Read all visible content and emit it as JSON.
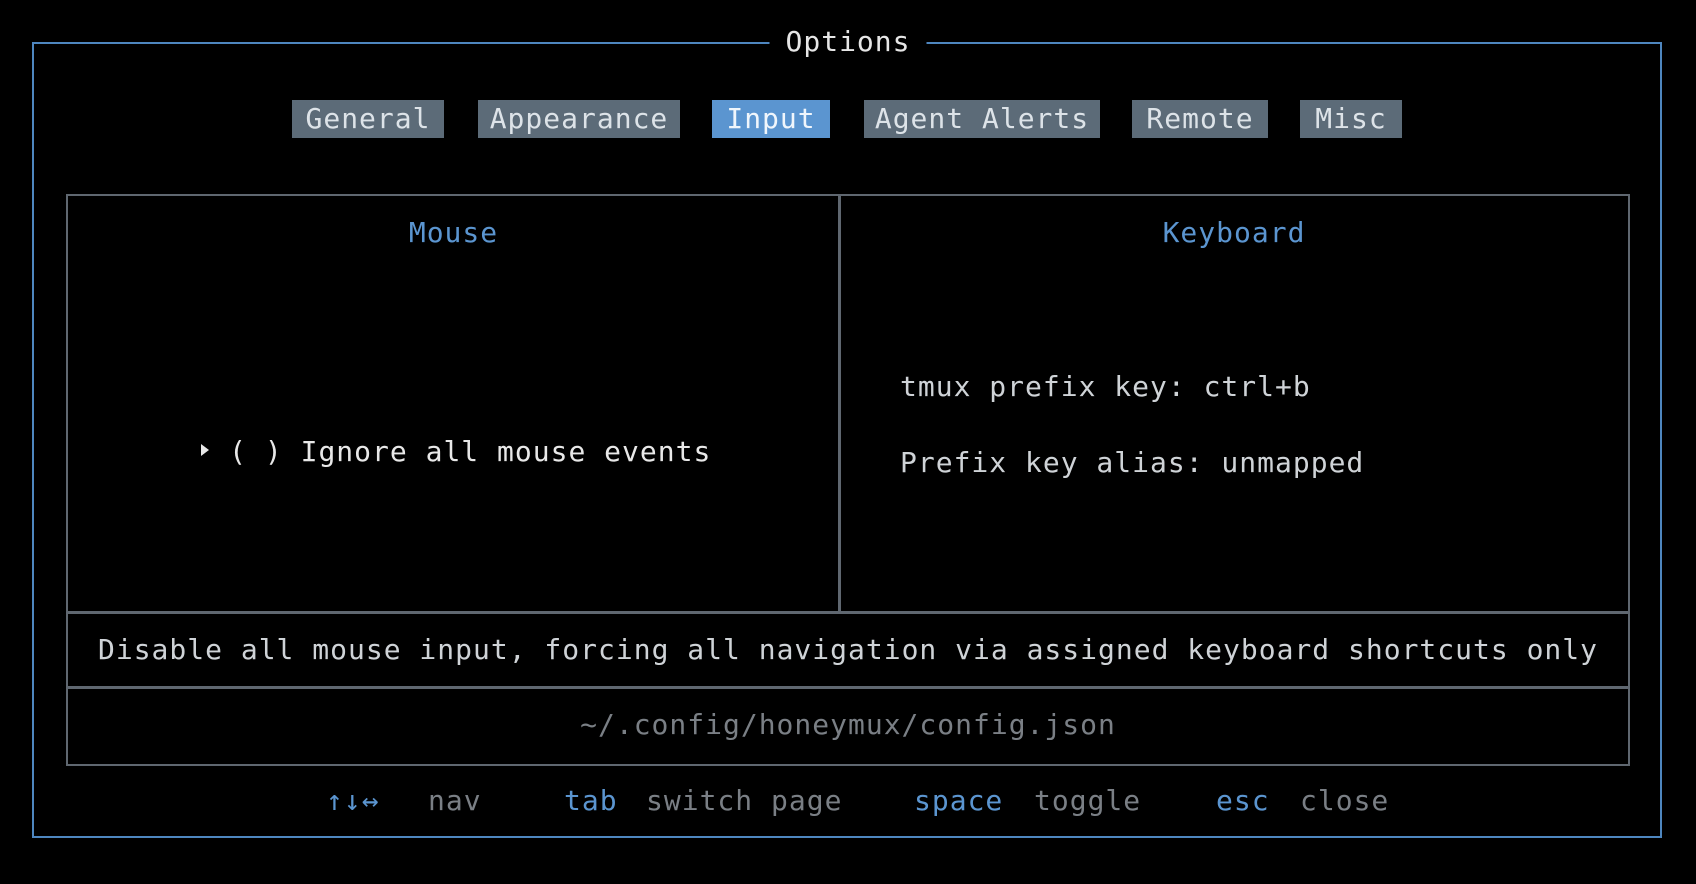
{
  "window": {
    "title": "Options"
  },
  "tabs": [
    {
      "label": "General",
      "active": false
    },
    {
      "label": "Appearance",
      "active": false
    },
    {
      "label": "Input",
      "active": true
    },
    {
      "label": "Agent Alerts",
      "active": false
    },
    {
      "label": "Remote",
      "active": false
    },
    {
      "label": "Misc",
      "active": false
    }
  ],
  "mouse": {
    "heading": "Mouse",
    "options": [
      {
        "checkbox": "( )",
        "label": "Ignore all mouse events",
        "checked": false,
        "selected": true
      }
    ]
  },
  "keyboard": {
    "heading": "Keyboard",
    "lines": [
      "tmux prefix key: ctrl+b",
      "Prefix key alias: unmapped"
    ]
  },
  "description": "Disable all mouse input, forcing all navigation via assigned keyboard shortcuts only",
  "config_path": "~/.config/honeymux/config.json",
  "footer": {
    "hints": [
      {
        "key": "↑↓↔",
        "action": "nav"
      },
      {
        "key": "tab",
        "action": "switch page"
      },
      {
        "key": "space",
        "action": "toggle"
      },
      {
        "key": "esc",
        "action": "close"
      }
    ]
  },
  "colors": {
    "accent": "#5b95d0",
    "frame": "#4e86bf",
    "tab_inactive": "#5c6b78",
    "background": "#000000"
  }
}
